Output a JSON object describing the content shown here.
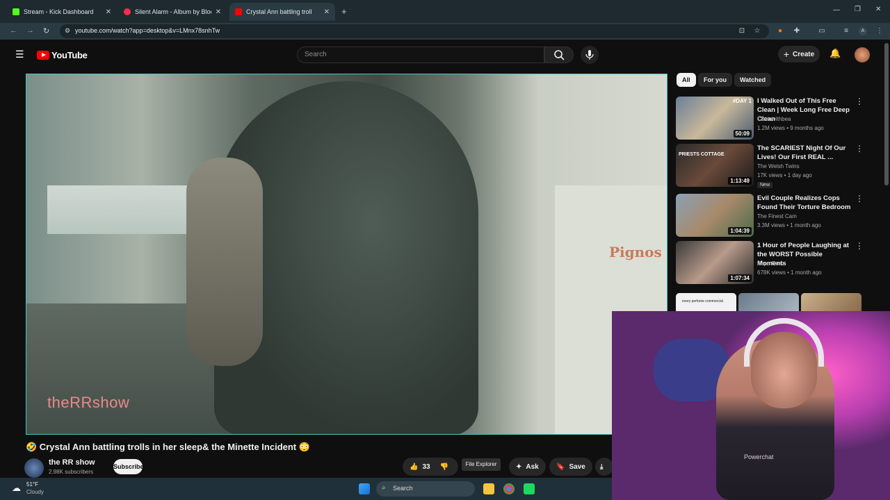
{
  "browser": {
    "tabs": [
      {
        "title": "Stream - Kick Dashboard",
        "color": "#53fc18"
      },
      {
        "title": "Silent Alarm - Album by Bloc Pa",
        "color": "#fa2d48"
      },
      {
        "title": "Crystal Ann battling troll",
        "color": "#ff0000"
      }
    ],
    "new_tab": "+",
    "url": "youtube.com/watch?app=desktop&v=LMnx78snhTw"
  },
  "youtube": {
    "logo": "YouTube",
    "search_placeholder": "Search",
    "create_label": "Create",
    "chips": [
      "All",
      "For you",
      "Watched"
    ],
    "video": {
      "watermark": "theRRshow",
      "sign": "Pignos",
      "title": "🤣 Crystal Ann battling trolls in her sleep& the Minette Incident 😳",
      "channel": "the RR show",
      "subscribers": "2.98K subscribers",
      "subscribe": "Subscribe",
      "likes": "33",
      "ask": "Ask",
      "save": "Save",
      "tooltip": "File Explorer"
    },
    "recommendations": [
      {
        "title": "I Walked Out of This Free Clean | Week Long Free Deep Clean",
        "channel": "Cleanwithbea",
        "meta": "1.2M views • 9 months ago",
        "duration": "50:09",
        "thumb_label": "#DAY 1",
        "badge": ""
      },
      {
        "title": "The SCARIEST Night Of Our Lives! Our First REAL ...",
        "channel": "The Welsh Twins",
        "meta": "17K views • 1 day ago",
        "duration": "1:13:49",
        "thumb_label": "PRIESTS COTTAGE",
        "badge": "New"
      },
      {
        "title": "Evil Couple Realizes Cops Found Their Torture Bedroom",
        "channel": "The Finest Cam",
        "meta": "3.3M views • 1 month ago",
        "duration": "1:04:39",
        "thumb_label": "",
        "badge": ""
      },
      {
        "title": "1 Hour of People Laughing at the WORST Possible Moments",
        "channel": "Papa Ruzz",
        "meta": "678K views • 1 month ago",
        "duration": "1:07:34",
        "thumb_label": "",
        "badge": ""
      }
    ],
    "shorts_label": "every perfume commercial"
  },
  "webcam": {
    "shirt_text": "Powerchat"
  },
  "taskbar": {
    "temp": "51°F",
    "condition": "Cloudy",
    "search": "Search"
  }
}
